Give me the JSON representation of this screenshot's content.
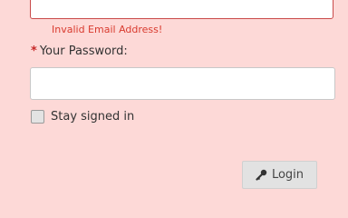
{
  "email": {
    "value": "",
    "error": "Invalid Email Address!"
  },
  "password": {
    "required_marker": "*",
    "label": "Your Password:",
    "value": ""
  },
  "stay_signed_in": {
    "label": "Stay signed in",
    "checked": false
  },
  "login_button": {
    "label": "Login",
    "icon": "key-icon"
  },
  "colors": {
    "background": "#fdd9d7",
    "error": "#d93b2f",
    "required": "#c62828"
  }
}
